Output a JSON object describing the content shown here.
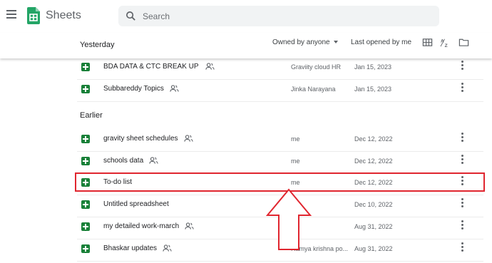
{
  "app": {
    "title": "Sheets"
  },
  "search": {
    "placeholder": "Search"
  },
  "toolbar": {
    "owner_filter": "Owned by anyone",
    "sort": "Last opened by me"
  },
  "sections": {
    "yesterday": "Yesterday",
    "earlier": "Earlier"
  },
  "files": [
    {
      "name": "BDA DATA & CTC BREAK UP",
      "shared": true,
      "owner": "Graviity cloud HR",
      "date": "Jan 15, 2023"
    },
    {
      "name": "Subbareddy Topics",
      "shared": true,
      "owner": "Jinka Narayana",
      "date": "Jan 15, 2023"
    },
    {
      "name": "gravity sheet schedules",
      "shared": true,
      "owner": "me",
      "date": "Dec 12, 2022"
    },
    {
      "name": "schools data",
      "shared": true,
      "owner": "me",
      "date": "Dec 12, 2022"
    },
    {
      "name": "To-do list",
      "shared": false,
      "owner": "me",
      "date": "Dec 12, 2022"
    },
    {
      "name": "Untitled spreadsheet",
      "shared": false,
      "owner": "me",
      "date": "Dec 10, 2022"
    },
    {
      "name": "my detailed work-march",
      "shared": true,
      "owner": "me",
      "date": "Aug 31, 2022"
    },
    {
      "name": "Bhaskar updates",
      "shared": true,
      "owner": "Ramya krishna po...",
      "date": "Aug 31, 2022"
    }
  ],
  "annotation": {
    "highlighted_file": "To-do list",
    "color": "#e0262f"
  },
  "colors": {
    "brand": "#188038",
    "icon": "#5f6368"
  }
}
